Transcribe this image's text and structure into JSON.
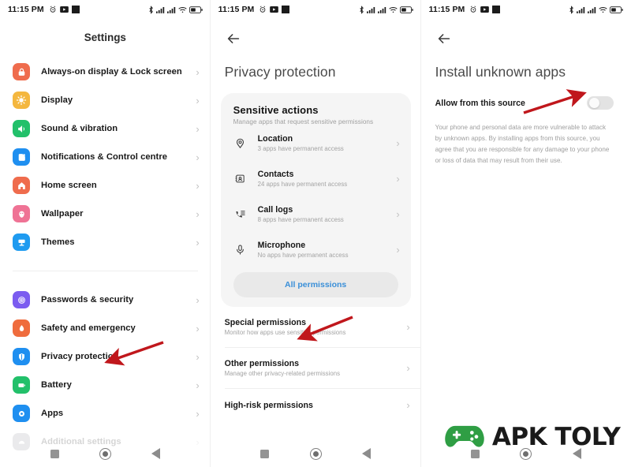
{
  "status_bar": {
    "time": "11:15 PM",
    "left_icons": [
      "alarm-icon",
      "video-icon",
      "screen-record-icon"
    ],
    "right_icons": [
      "bluetooth-icon",
      "signal-bars-1-icon",
      "signal-bars-2-icon",
      "wifi-icon",
      "battery-icon"
    ]
  },
  "colors": {
    "accent_blue": "#3a8fd8",
    "arrow_red": "#c0171c",
    "watermark_green": "#2f9e44",
    "chevron_grey": "#c2c2c2"
  },
  "panel_settings": {
    "title": "Settings",
    "groups": [
      {
        "items": [
          {
            "label": "Always-on display & Lock screen",
            "icon": "lock-icon",
            "color": "#ef6c4d"
          },
          {
            "label": "Display",
            "icon": "brightness-icon",
            "color": "#f4b73f"
          },
          {
            "label": "Sound & vibration",
            "icon": "speaker-icon",
            "color": "#22c06a"
          },
          {
            "label": "Notifications & Control centre",
            "icon": "notification-icon",
            "color": "#1f8ff0"
          },
          {
            "label": "Home screen",
            "icon": "home-icon",
            "color": "#ef6c4d"
          },
          {
            "label": "Wallpaper",
            "icon": "wallpaper-icon",
            "color": "#ef7395"
          },
          {
            "label": "Themes",
            "icon": "themes-icon",
            "color": "#1f9bf0"
          }
        ]
      },
      {
        "items": [
          {
            "label": "Passwords & security",
            "icon": "fingerprint-icon",
            "color": "#7b5cf0"
          },
          {
            "label": "Safety and emergency",
            "icon": "emergency-icon",
            "color": "#ef6c3d"
          },
          {
            "label": "Privacy protection",
            "icon": "privacy-shield-icon",
            "color": "#1f8ff0"
          },
          {
            "label": "Battery",
            "icon": "battery-icon",
            "color": "#22c06a"
          },
          {
            "label": "Apps",
            "icon": "apps-icon",
            "color": "#1f8ff0"
          },
          {
            "label": "Additional settings",
            "icon": "additional-settings-icon",
            "color": "#8e9198"
          }
        ]
      }
    ]
  },
  "panel_privacy": {
    "title": "Privacy protection",
    "back_icon": "back-arrow-icon",
    "card": {
      "heading": "Sensitive actions",
      "subheading": "Manage apps that request sensitive permissions",
      "rows": [
        {
          "title": "Location",
          "sub": "3 apps have permanent access",
          "icon": "location-pin-icon"
        },
        {
          "title": "Contacts",
          "sub": "24 apps have permanent access",
          "icon": "contacts-icon"
        },
        {
          "title": "Call logs",
          "sub": "8 apps have permanent access",
          "icon": "call-logs-icon"
        },
        {
          "title": "Microphone",
          "sub": "No apps have permanent access",
          "icon": "microphone-icon"
        }
      ],
      "all_permissions_label": "All permissions"
    },
    "other_rows": [
      {
        "title": "Special permissions",
        "sub": "Monitor how apps use sensitive permissions"
      },
      {
        "title": "Other permissions",
        "sub": "Manage other privacy-related permissions"
      },
      {
        "title": "High-risk permissions",
        "sub": ""
      }
    ]
  },
  "panel_install": {
    "title": "Install unknown apps",
    "back_icon": "back-arrow-icon",
    "allow_label": "Allow from this source",
    "toggle_state": "off",
    "warning": "Your phone and personal data are more vulnerable to attack by unknown apps. By installing apps from this source, you agree that you are responsible for any damage to your phone or loss of data that may result from their use."
  },
  "nav_bar": {
    "recents_icon": "recents-square-icon",
    "home_icon": "home-circle-icon",
    "back_icon": "back-triangle-icon"
  },
  "watermark": {
    "text": "APK TOLY",
    "icon": "gamepad-icon"
  },
  "annotations": [
    {
      "name": "arrow-to-privacy-protection",
      "target": "Privacy protection"
    },
    {
      "name": "arrow-to-special-permissions",
      "target": "Special permissions"
    },
    {
      "name": "arrow-to-allow-toggle",
      "target": "Allow from this source"
    }
  ]
}
